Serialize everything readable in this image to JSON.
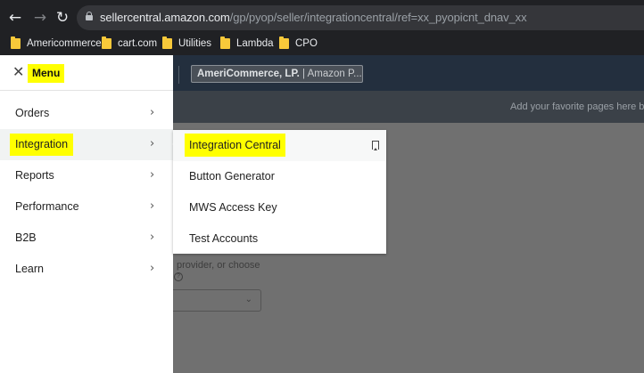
{
  "browser": {
    "url_host": "sellercentral.amazon.com",
    "url_path": "/gp/pyop/seller/integrationcentral/ref=xx_pyopicnt_dnav_xx",
    "bookmarks": [
      {
        "label": "Americommerce"
      },
      {
        "label": "cart.com"
      },
      {
        "label": "Utilities"
      },
      {
        "label": "Lambda"
      },
      {
        "label": "CPO"
      }
    ]
  },
  "page": {
    "account_name": "AmeriCommerce, LP.",
    "account_suffix": " | Amazon P...",
    "favorites_hint": "Add your favorite pages here by",
    "provider_text": "provider, or choose"
  },
  "menu": {
    "title": "Menu",
    "items": [
      {
        "label": "Orders"
      },
      {
        "label": "Integration"
      },
      {
        "label": "Reports"
      },
      {
        "label": "Performance"
      },
      {
        "label": "B2B"
      },
      {
        "label": "Learn"
      }
    ]
  },
  "submenu": {
    "items": [
      {
        "label": "Integration Central"
      },
      {
        "label": "Button Generator"
      },
      {
        "label": "MWS Access Key"
      },
      {
        "label": "Test Accounts"
      }
    ]
  },
  "colors": {
    "highlight": "#ffff00",
    "amazon_header": "#232f3e"
  }
}
